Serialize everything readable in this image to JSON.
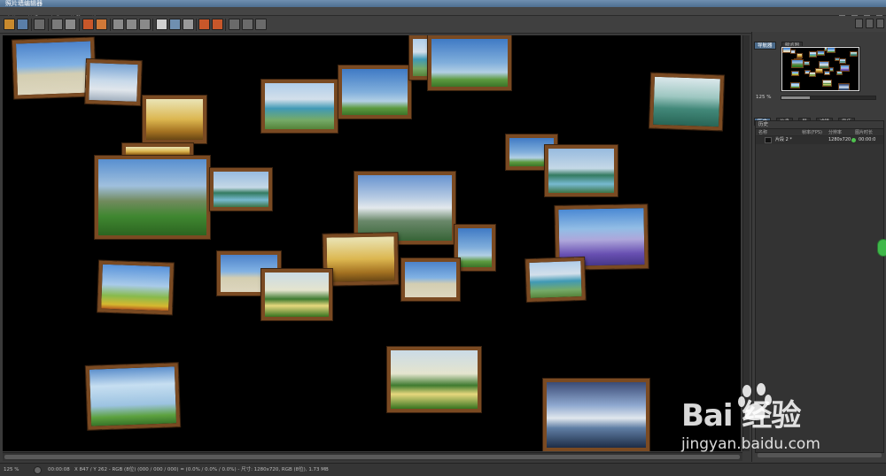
{
  "window": {
    "title": "照片墙编辑器"
  },
  "menu": [
    {
      "label": "文件"
    },
    {
      "label": "编辑"
    },
    {
      "label": "查看"
    },
    {
      "label": "片段"
    },
    {
      "label": "选项"
    }
  ],
  "navigator": {
    "tabs": [
      {
        "label": "导航器",
        "active": true
      },
      {
        "label": "预览图",
        "active": false
      }
    ],
    "zoom_label": "125 %",
    "zoom_fraction": 0.3
  },
  "history": {
    "tabs": [
      {
        "label": "历史",
        "active": true
      },
      {
        "label": "信息",
        "active": false
      },
      {
        "label": "层",
        "active": false
      },
      {
        "label": "滤镜",
        "active": false
      },
      {
        "label": "宣传",
        "active": false
      }
    ],
    "title": "历史",
    "columns": {
      "name": "名称",
      "fps": "帧率(FPS)",
      "resolution": "分辨率",
      "duration": "图片时长"
    },
    "rows": [
      {
        "name": "片段 2 *",
        "resolution": "1280x720",
        "duration": "00:00:0"
      }
    ]
  },
  "status": {
    "zoom": "125 %",
    "time": "00:00:08",
    "info": "X 847 / Y 262 - RGB (8位) (000 / 000 / 000) = (0.0% / 0.0% / 0.0%) - 尺寸: 1280x720, RGB (8位), 1.73 MB"
  },
  "watermark": {
    "logo": "Bai  经验",
    "url": "jingyan.baidu.com"
  },
  "colors": {
    "frame": "#7a4a22",
    "accent_tab": "#4a6a8a",
    "status_dot": "#4ec34e"
  },
  "photos": [
    {
      "name": "beach-palm",
      "scene": "beach"
    },
    {
      "name": "snow-rocks",
      "scene": "snow"
    },
    {
      "name": "golden-field",
      "scene": "golden"
    },
    {
      "name": "small-golden",
      "scene": "golden"
    },
    {
      "name": "mountain-valley",
      "scene": "mountain"
    },
    {
      "name": "lake-village",
      "scene": "lake"
    },
    {
      "name": "coast-bay",
      "scene": "coast"
    },
    {
      "name": "sky-meadow",
      "scene": "sky"
    },
    {
      "name": "coast-bay-2",
      "scene": "coast"
    },
    {
      "name": "cloud-sea",
      "scene": "sky"
    },
    {
      "name": "green-lake",
      "scene": "greenlake"
    },
    {
      "name": "sun-field",
      "scene": "sky"
    },
    {
      "name": "lake-island",
      "scene": "lake"
    },
    {
      "name": "lavender",
      "scene": "lavender"
    },
    {
      "name": "misty-mountain",
      "scene": "misty"
    },
    {
      "name": "green-hills",
      "scene": "sky"
    },
    {
      "name": "golden-lake",
      "scene": "golden"
    },
    {
      "name": "tropical-beach",
      "scene": "beach"
    },
    {
      "name": "coast-rocks",
      "scene": "coast"
    },
    {
      "name": "flower-meadow",
      "scene": "flower"
    },
    {
      "name": "beach-2",
      "scene": "beach"
    },
    {
      "name": "tree-sunset",
      "scene": "tree"
    },
    {
      "name": "sun-flowers",
      "scene": "sunny"
    },
    {
      "name": "tree-bench",
      "scene": "tree"
    },
    {
      "name": "ice-kayak",
      "scene": "ice"
    }
  ]
}
